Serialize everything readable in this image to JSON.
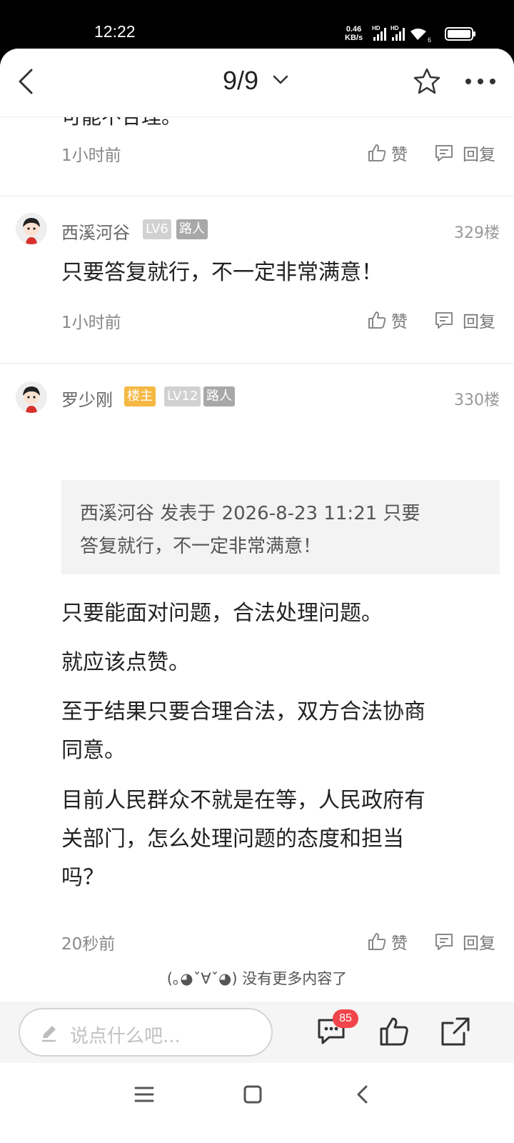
{
  "status_bar": {
    "time": "12:22",
    "net_speed": "0.46",
    "net_unit": "KB/s"
  },
  "header": {
    "page_indicator": "9/9"
  },
  "feed": {
    "previous": {
      "cut_text": "可能不合理。",
      "time": "1小时前"
    },
    "actions": {
      "like": "赞",
      "reply": "回复"
    },
    "comments": [
      {
        "user": "西溪河谷",
        "level": "LV6",
        "tag": "路人",
        "floor": "329楼",
        "text": "只要答复就行，不一定非常满意！",
        "time": "1小时前"
      },
      {
        "user": "罗少刚",
        "host_badge": "楼主",
        "level": "LV12",
        "tag": "路人",
        "floor": "330楼",
        "quote_line1": "西溪河谷 发表于 2026-8-23 11:21 只要",
        "quote_line2": "答复就行，不一定非常满意！",
        "p1": "只要能面对问题，合法处理问题。",
        "p2": "就应该点赞。",
        "p3_line1": "至于结果只要合理合法，双方合法协商",
        "p3_line2": "同意。",
        "p4_line1": "目前人民群众不就是在等，人民政府有",
        "p4_line2": "关部门，怎么处理问题的态度和担当",
        "p4_line3": "吗？",
        "time": "20秒前"
      }
    ],
    "end_text": "(｡◕ˇ∀ˇ◕) 没有更多内容了"
  },
  "bottom_bar": {
    "input_placeholder": "说点什么吧...",
    "comment_count": "85"
  }
}
